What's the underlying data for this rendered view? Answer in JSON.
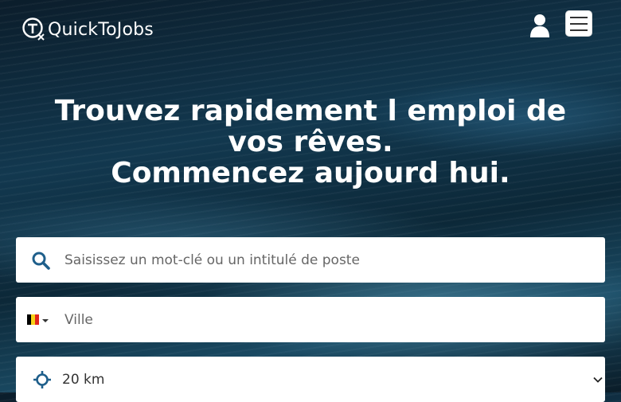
{
  "brand": {
    "name": "QuickToJobs"
  },
  "header": {
    "account_icon": "user-icon",
    "menu_icon": "hamburger-icon"
  },
  "hero": {
    "line1": "Trouvez rapidement l emploi de",
    "line2": "vos rêves.",
    "line3": "Commencez aujourd hui."
  },
  "search": {
    "keyword_placeholder": "Saisissez un mot-clé ou un intitulé de poste",
    "keyword_icon": "search-icon",
    "city_placeholder": "Ville",
    "country_flag": "belgium-flag",
    "radius_value": "20 km",
    "radius_icon": "crosshair-icon"
  },
  "colors": {
    "accent": "#1f5f8b",
    "flag_black": "#000000",
    "flag_yellow": "#f7d117",
    "flag_red": "#e1261c"
  }
}
